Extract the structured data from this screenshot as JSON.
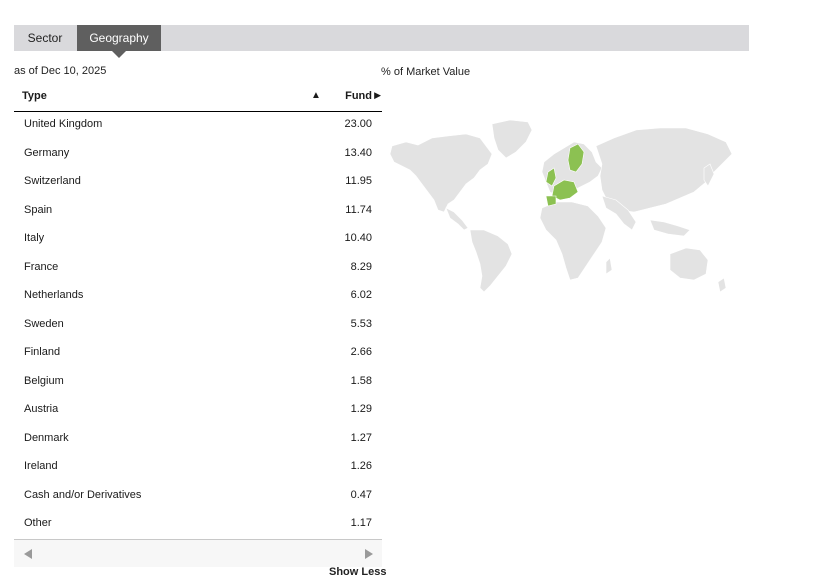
{
  "tabs": [
    {
      "label": "Sector",
      "active": false
    },
    {
      "label": "Geography",
      "active": true
    }
  ],
  "as_of": "as of Dec 10, 2025",
  "map": {
    "title": "% of Market Value",
    "land_color": "#e3e3e3",
    "highlight_color": "#8cc152"
  },
  "table": {
    "col_type": "Type",
    "col_sort_icon": "▲",
    "col_fund": "Fund",
    "col_fund_icon": "▶",
    "rows": [
      {
        "name": "United Kingdom",
        "value": "23.00"
      },
      {
        "name": "Germany",
        "value": "13.40"
      },
      {
        "name": "Switzerland",
        "value": "11.95"
      },
      {
        "name": "Spain",
        "value": "11.74"
      },
      {
        "name": "Italy",
        "value": "10.40"
      },
      {
        "name": "France",
        "value": "8.29"
      },
      {
        "name": "Netherlands",
        "value": "6.02"
      },
      {
        "name": "Sweden",
        "value": "5.53"
      },
      {
        "name": "Finland",
        "value": "2.66"
      },
      {
        "name": "Belgium",
        "value": "1.58"
      },
      {
        "name": "Austria",
        "value": "1.29"
      },
      {
        "name": "Denmark",
        "value": "1.27"
      },
      {
        "name": "Ireland",
        "value": "1.26"
      },
      {
        "name": "Cash and/or Derivatives",
        "value": "0.47"
      },
      {
        "name": "Other",
        "value": "1.17"
      }
    ]
  },
  "show_less": "Show Less"
}
